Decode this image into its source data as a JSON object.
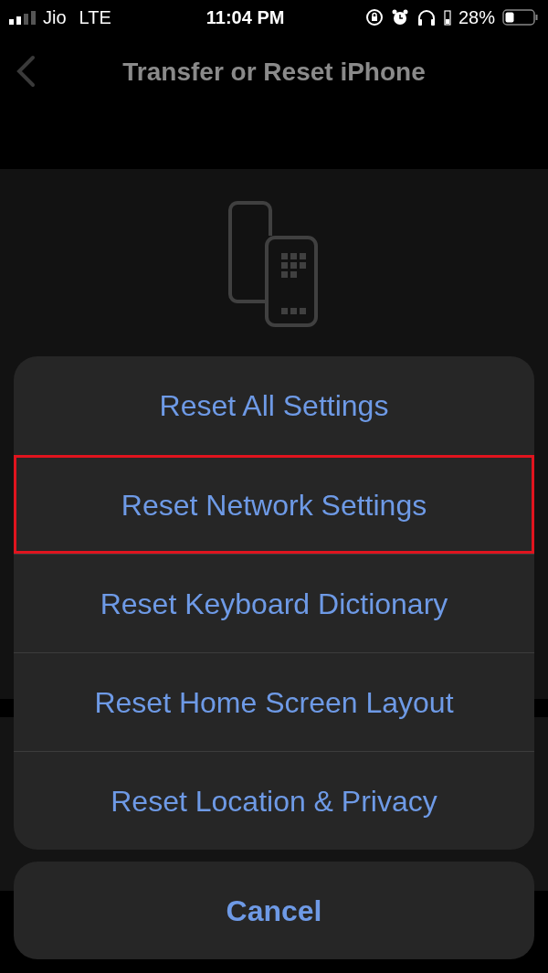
{
  "status_bar": {
    "carrier": "Jio",
    "network": "LTE",
    "time": "11:04 PM",
    "battery": "28%"
  },
  "nav": {
    "title": "Transfer or Reset iPhone"
  },
  "action_sheet": {
    "items": [
      {
        "label": "Reset All Settings",
        "highlighted": false
      },
      {
        "label": "Reset Network Settings",
        "highlighted": true
      },
      {
        "label": "Reset Keyboard Dictionary",
        "highlighted": false
      },
      {
        "label": "Reset Home Screen Layout",
        "highlighted": false
      },
      {
        "label": "Reset Location & Privacy",
        "highlighted": false
      }
    ],
    "cancel": "Cancel"
  }
}
